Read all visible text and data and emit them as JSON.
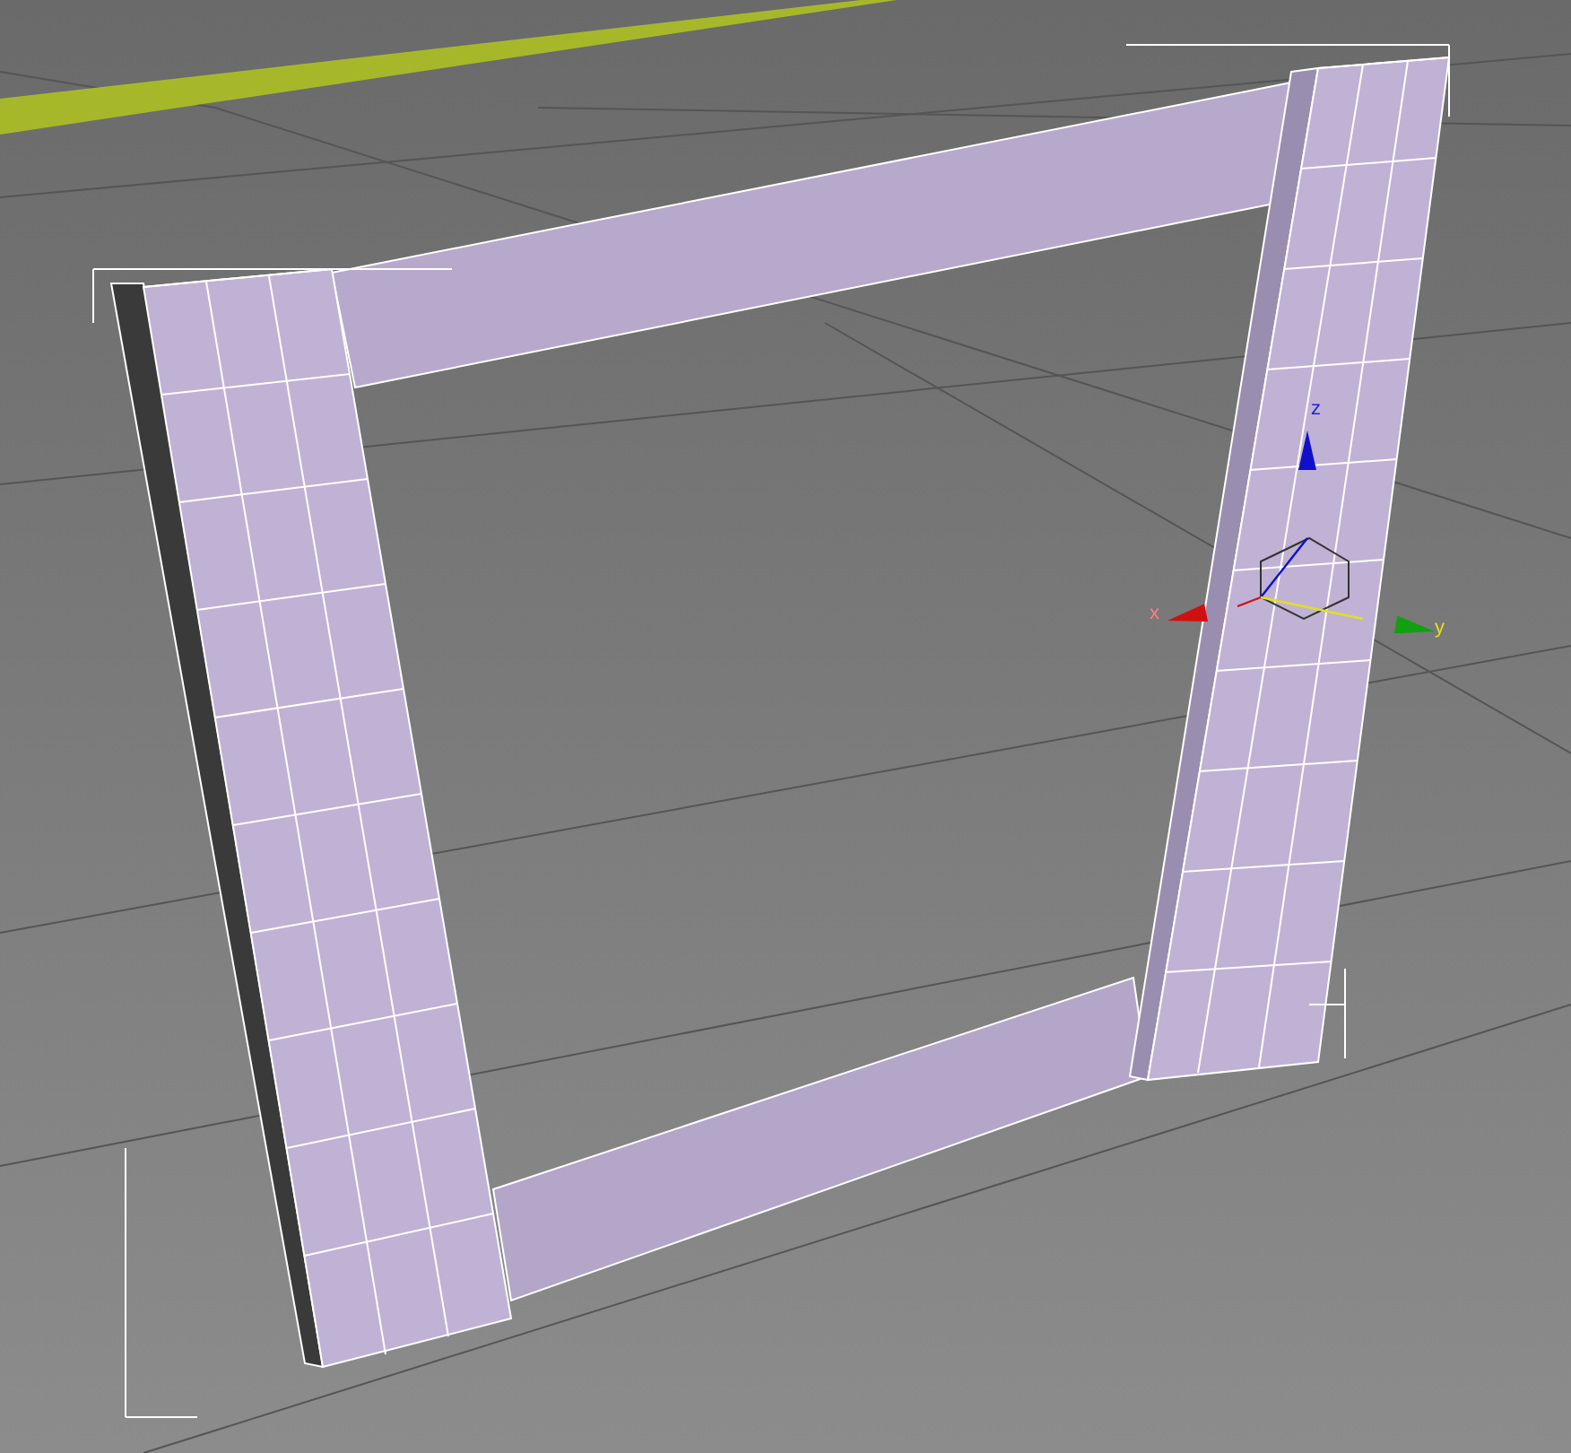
{
  "viewport": {
    "gizmo": {
      "axes": [
        {
          "kind": "z",
          "label": "z",
          "color": "#1010c8"
        },
        {
          "kind": "x",
          "label": "x",
          "color": "#d01010"
        },
        {
          "kind": "y",
          "label": "y",
          "color": "#10a010"
        }
      ]
    }
  }
}
